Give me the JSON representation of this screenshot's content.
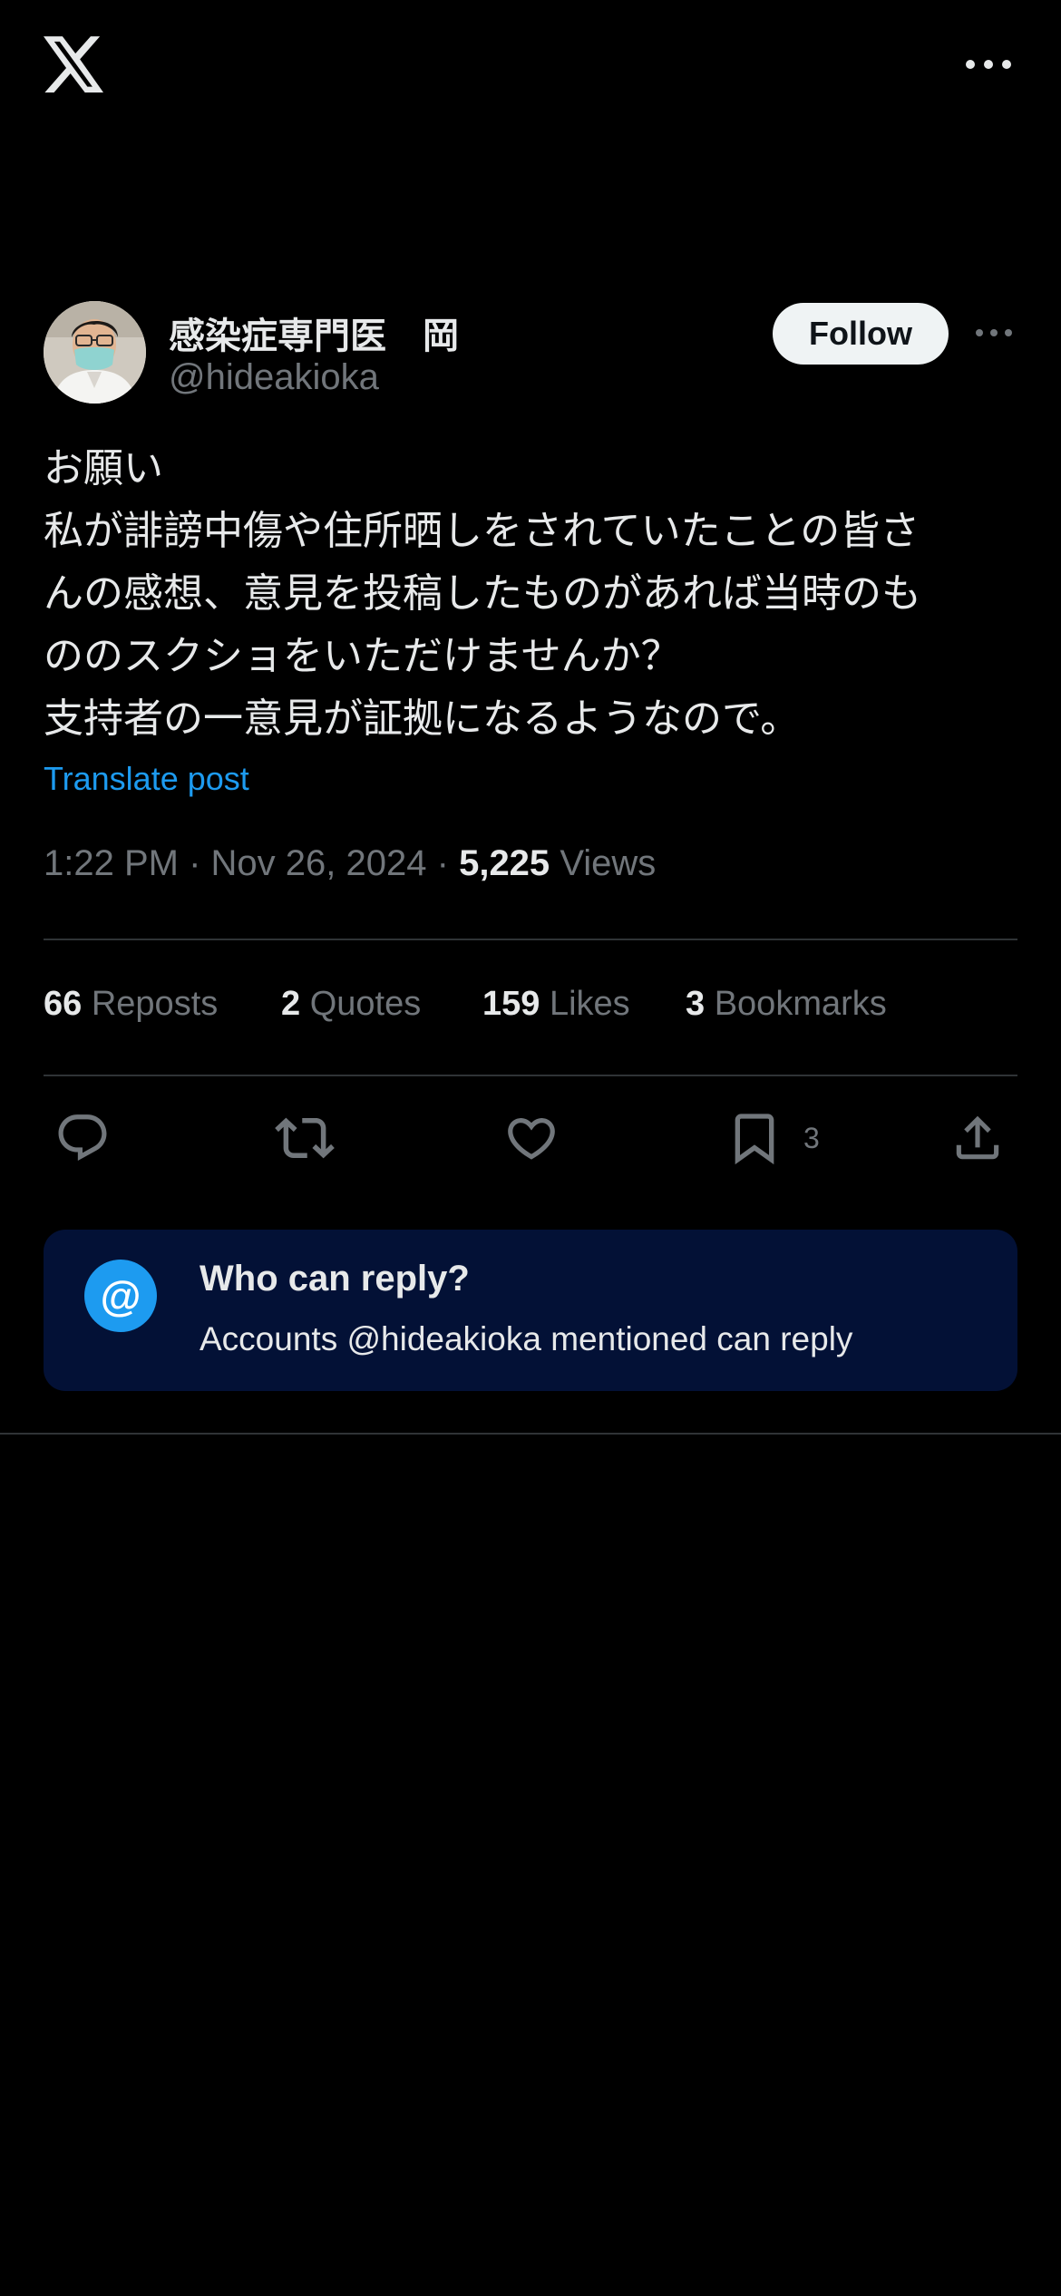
{
  "topbar": {
    "logo_icon": "x-logo-icon",
    "more_icon": "more-horizontal-icon"
  },
  "author": {
    "display_name": "感染症専門医　岡",
    "handle": "@hideakioka",
    "follow_label": "Follow",
    "more_icon": "more-horizontal-icon"
  },
  "post": {
    "lines": [
      "お願い",
      "私が誹謗中傷や住所晒しをされていたことの皆さ",
      "んの感想、意見を投稿したものがあれば当時のも",
      "ののスクショをいただけませんか？",
      "支持者の一意見が証拠になるようなので。"
    ],
    "translate_label": "Translate post"
  },
  "meta": {
    "time": "1:22 PM",
    "separator": "·",
    "date": "Nov 26, 2024",
    "views_count": "5,225",
    "views_label": "Views"
  },
  "stats": {
    "reposts_count": "66",
    "reposts_label": "Reposts",
    "quotes_count": "2",
    "quotes_label": "Quotes",
    "likes_count": "159",
    "likes_label": "Likes",
    "bookmarks_count": "3",
    "bookmarks_label": "Bookmarks"
  },
  "actions": {
    "reply_icon": "reply-icon",
    "repost_icon": "repost-icon",
    "like_icon": "heart-icon",
    "bookmark_icon": "bookmark-icon",
    "bookmark_count": "3",
    "share_icon": "share-icon"
  },
  "reply_settings": {
    "badge": "@",
    "title": "Who can reply?",
    "subtitle": "Accounts @hideakioka mentioned can reply"
  },
  "colors": {
    "background": "#000000",
    "text_primary": "#e7e9ea",
    "text_secondary": "#71767b",
    "accent": "#1d9bf0",
    "card_background": "#031136",
    "divider": "#2f3336"
  }
}
